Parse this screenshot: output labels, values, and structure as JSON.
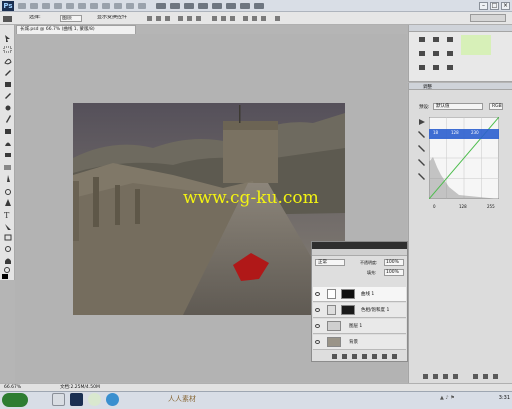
{
  "app": {
    "logo": "Ps"
  },
  "window_buttons": [
    "–",
    "□",
    "×"
  ],
  "options_bar": {
    "select_label": "选择:",
    "select_value": "图层",
    "auto_select_label": "显示变换控件",
    "icons": [
      "align-top-icon",
      "align-middle-icon",
      "align-bottom-icon",
      "align-left-icon",
      "align-center-icon",
      "align-right-icon",
      "distribute-icon"
    ]
  },
  "document": {
    "tab_title": "长城.psd @ 66.7% (曲线 1, 蒙版/8)",
    "status_zoom": "66.67%",
    "status_doc": "文档:2.25M/4.50M"
  },
  "watermark": "www.cg-ku.com",
  "panels": {
    "adjustments": {
      "title": "调整",
      "preset_label": "预设:",
      "preset_value": "默认值",
      "channel_value": "RGB",
      "input_values": [
        "18",
        "128",
        "230"
      ],
      "output_values": [
        "0",
        "128",
        "255"
      ],
      "curve_points": [
        [
          0,
          0
        ],
        [
          128,
          128
        ],
        [
          255,
          255
        ]
      ]
    },
    "layers": {
      "blend_mode": "正常",
      "opacity_label": "不透明度:",
      "opacity": "100%",
      "fill_label": "填充:",
      "fill": "100%",
      "items": [
        {
          "name": "曲线 1"
        },
        {
          "name": "色相/饱和度 1"
        },
        {
          "name": "图层 1"
        },
        {
          "name": "背景"
        }
      ]
    }
  },
  "taskbar": {
    "clock": "3:31",
    "brand_watermark": "人人素材"
  },
  "colors": {
    "accent_blue": "#2b5fcf",
    "watermark_yellow": "#f3f312",
    "curve_green": "#4dbd4d",
    "leaf_red": "#b01818"
  }
}
